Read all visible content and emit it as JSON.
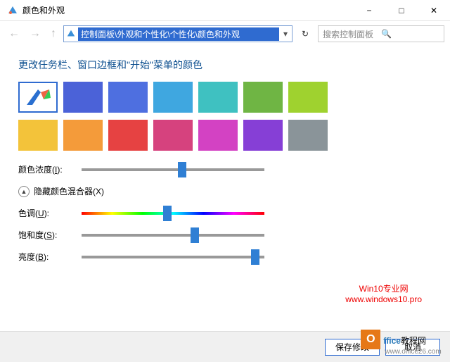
{
  "window": {
    "title": "颜色和外观"
  },
  "nav": {
    "address": "控制面板\\外观和个性化\\个性化\\颜色和外观",
    "search_placeholder": "搜索控制面板"
  },
  "heading": "更改任务栏、窗口边框和\"开始\"菜单的颜色",
  "swatches_row1": [
    "auto",
    "#4b62d8",
    "#4e6fe0",
    "#3fa7e0",
    "#3fc1c1",
    "#6fb544",
    "#9fd22f"
  ],
  "swatches_row2": [
    "#f3c33a",
    "#f49b3a",
    "#e64242",
    "#d6427e",
    "#d342c3",
    "#863fd6",
    "#8a9499"
  ],
  "sliders": {
    "intensity": {
      "label": "颜色浓度",
      "key": "I",
      "pos": 0.55
    },
    "mixer_label": "隐藏颜色混合器",
    "mixer_key": "X",
    "hue": {
      "label": "色调",
      "key": "U",
      "pos": 0.47
    },
    "sat": {
      "label": "饱和度",
      "key": "S",
      "pos": 0.62
    },
    "bri": {
      "label": "亮度",
      "key": "B",
      "pos": 0.95
    }
  },
  "footer": {
    "save": "保存修改",
    "cancel": "取消"
  },
  "watermark": {
    "l1": "Win10专业网",
    "l2": "www.windows10.pro"
  },
  "logo": {
    "brand1": "ffice",
    "brand2": "教程网",
    "url": "www.office26.com"
  }
}
